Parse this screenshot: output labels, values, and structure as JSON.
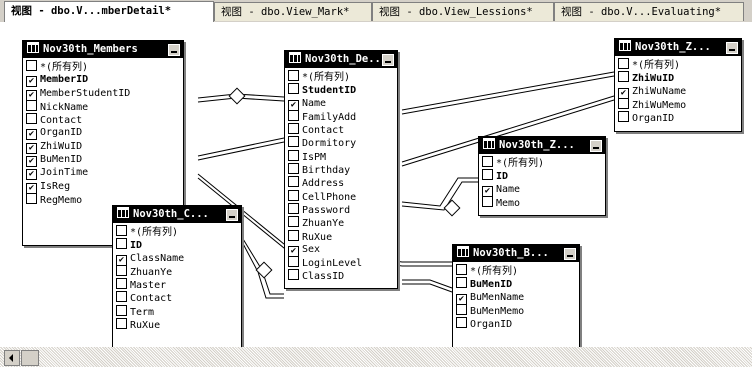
{
  "tabs": [
    {
      "label": "视图 - dbo.V...mberDetail*",
      "active": true
    },
    {
      "label": "视图 - dbo.View_Mark*",
      "active": false
    },
    {
      "label": "视图 - dbo.View_Lessions*",
      "active": false
    },
    {
      "label": "视图 - dbo.V...Evaluating*",
      "active": false
    }
  ],
  "tables": [
    {
      "id": "members",
      "title": "Nov30th_Members",
      "rows": [
        {
          "label": "*(所有列)",
          "checked": false,
          "pk": false
        },
        {
          "label": "MemberID",
          "checked": true,
          "pk": true
        },
        {
          "label": "MemberStudentID",
          "checked": true,
          "pk": false
        },
        {
          "label": "NickName",
          "checked": false,
          "pk": false
        },
        {
          "label": "Contact",
          "checked": false,
          "pk": false
        },
        {
          "label": "OrganID",
          "checked": true,
          "pk": false
        },
        {
          "label": "ZhiWuID",
          "checked": true,
          "pk": false
        },
        {
          "label": "BuMenID",
          "checked": true,
          "pk": false
        },
        {
          "label": "JoinTime",
          "checked": true,
          "pk": false
        },
        {
          "label": "IsReg",
          "checked": true,
          "pk": false
        },
        {
          "label": "RegMemo",
          "checked": false,
          "pk": false
        }
      ]
    },
    {
      "id": "details",
      "title": "Nov30th_De...",
      "rows": [
        {
          "label": "*(所有列)",
          "checked": false,
          "pk": false
        },
        {
          "label": "StudentID",
          "checked": false,
          "pk": true
        },
        {
          "label": "Name",
          "checked": true,
          "pk": false
        },
        {
          "label": "FamilyAdd",
          "checked": false,
          "pk": false
        },
        {
          "label": "Contact",
          "checked": false,
          "pk": false
        },
        {
          "label": "Dormitory",
          "checked": false,
          "pk": false
        },
        {
          "label": "IsPM",
          "checked": false,
          "pk": false
        },
        {
          "label": "Birthday",
          "checked": false,
          "pk": false
        },
        {
          "label": "Address",
          "checked": false,
          "pk": false
        },
        {
          "label": "CellPhone",
          "checked": false,
          "pk": false
        },
        {
          "label": "Password",
          "checked": false,
          "pk": false
        },
        {
          "label": "ZhuanYe",
          "checked": false,
          "pk": false
        },
        {
          "label": "RuXue",
          "checked": false,
          "pk": false
        },
        {
          "label": "Sex",
          "checked": true,
          "pk": false
        },
        {
          "label": "LoginLevel",
          "checked": false,
          "pk": false
        },
        {
          "label": "ClassID",
          "checked": false,
          "pk": false
        }
      ]
    },
    {
      "id": "zhiwu",
      "title": "Nov30th_Z...",
      "rows": [
        {
          "label": "*(所有列)",
          "checked": false,
          "pk": false
        },
        {
          "label": "ZhiWuID",
          "checked": false,
          "pk": true
        },
        {
          "label": "ZhiWuName",
          "checked": true,
          "pk": false
        },
        {
          "label": "ZhiWuMemo",
          "checked": false,
          "pk": false
        },
        {
          "label": "OrganID",
          "checked": false,
          "pk": false
        }
      ]
    },
    {
      "id": "zhuanye",
      "title": "Nov30th_Z...",
      "rows": [
        {
          "label": "*(所有列)",
          "checked": false,
          "pk": false
        },
        {
          "label": "ID",
          "checked": false,
          "pk": true
        },
        {
          "label": "Name",
          "checked": true,
          "pk": false
        },
        {
          "label": "Memo",
          "checked": false,
          "pk": false
        }
      ]
    },
    {
      "id": "classes",
      "title": "Nov30th_C...",
      "rows": [
        {
          "label": "*(所有列)",
          "checked": false,
          "pk": false
        },
        {
          "label": "ID",
          "checked": false,
          "pk": true
        },
        {
          "label": "ClassName",
          "checked": true,
          "pk": false
        },
        {
          "label": "ZhuanYe",
          "checked": false,
          "pk": false
        },
        {
          "label": "Master",
          "checked": false,
          "pk": false
        },
        {
          "label": "Contact",
          "checked": false,
          "pk": false
        },
        {
          "label": "Term",
          "checked": false,
          "pk": false
        },
        {
          "label": "RuXue",
          "checked": false,
          "pk": false
        }
      ]
    },
    {
      "id": "bumen",
      "title": "Nov30th_B...",
      "rows": [
        {
          "label": "*(所有列)",
          "checked": false,
          "pk": false
        },
        {
          "label": "BuMenID",
          "checked": false,
          "pk": true
        },
        {
          "label": "BuMenName",
          "checked": true,
          "pk": false
        },
        {
          "label": "BuMenMemo",
          "checked": false,
          "pk": false
        },
        {
          "label": "OrganID",
          "checked": false,
          "pk": false
        }
      ]
    }
  ],
  "check_glyph": "✔"
}
